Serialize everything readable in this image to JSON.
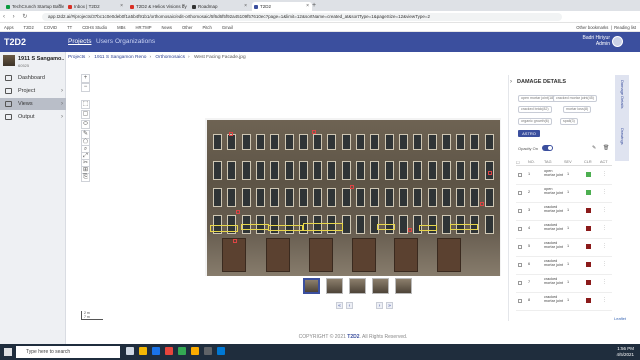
{
  "browser": {
    "tabs": [
      {
        "label": "TechCrunch Startup Battlefield 2",
        "color": "#0a9b3f"
      },
      {
        "label": "Inbox | T2D2",
        "color": "#d93025"
      },
      {
        "label": "T2D2 & Helios Visions by Thorn",
        "color": "#d93025"
      },
      {
        "label": "Roadmap",
        "color": "#333333"
      },
      {
        "label": "T2D2",
        "color": "#3b4f9e",
        "active": true
      }
    ],
    "url": "app.t2d2.ai/#/projects/37bc1c0e0deb0f1a5b4f91b1/orthomosaic/edit-orthomosaic/5f6d6f5f92a45109f57610ec?page=1&limit=12&sortName=created_at&sortType=1&pageSize=12&viewType=2",
    "bookmarks": [
      "Apps",
      "T2D2",
      "COVID",
      "TT",
      "CDHS Studio",
      "MBs",
      "HR:TMP",
      "News",
      "Other",
      "Pitch",
      "Gmail"
    ],
    "other_bookmarks": "Other bookmarks",
    "reading_list": "Reading list"
  },
  "app": {
    "logo": "T2D2",
    "nav": [
      "Projects",
      "Users",
      "Organizations"
    ],
    "user": {
      "name": "Badri Hiriyur",
      "role": "Admin"
    }
  },
  "sidebar": {
    "project_name": "1911 S Sangamo...",
    "project_sub": "60525",
    "items": [
      {
        "label": "Dashboard"
      },
      {
        "label": "Project"
      },
      {
        "label": "Views",
        "active": true
      },
      {
        "label": "Output"
      }
    ]
  },
  "breadcrumb": [
    "Projects",
    "1911 S Sangamon Reno",
    "Orthomosaics",
    "West Facing Facade.jpg"
  ],
  "viewer": {
    "toolbar": [
      "+",
      "−",
      "⬚",
      "▢",
      "⬭",
      "✎",
      "⬠",
      "⌕",
      "⤢",
      "✂",
      "⊞",
      "⎘"
    ],
    "thumb_count": 5,
    "pager": [
      "«",
      "‹",
      "›",
      "»"
    ],
    "scale": {
      "top": "2 m",
      "bottom": "7 m"
    }
  },
  "footer": {
    "prefix": "COPYRIGHT © 2021 ",
    "brand": "T2D2",
    "suffix": ". All Rights Reserved."
  },
  "leaflet": "Leaflet",
  "damage_panel": {
    "title": "DAMAGE DETAILS",
    "side_tabs": [
      "Damage Details",
      "Drawings"
    ],
    "chips": [
      "open mortar joint(18)",
      "cracked mortar joint(45)",
      "cracked brick(82)",
      "mortar loss(8)",
      "organic growth(6)",
      "spall(3)"
    ],
    "filter_button": "ASTRO",
    "opacity_label": "Opacity On",
    "columns": [
      "NO.",
      "TAG",
      "SEV",
      "CLR",
      "ACT"
    ],
    "rows": [
      {
        "no": "1",
        "tag": "open mortar joint",
        "sev": "1",
        "color": "#4caf50"
      },
      {
        "no": "2",
        "tag": "open mortar joint",
        "sev": "1",
        "color": "#4caf50"
      },
      {
        "no": "3",
        "tag": "cracked mortar joint",
        "sev": "1",
        "color": "#8b1a1a"
      },
      {
        "no": "4",
        "tag": "cracked mortar joint",
        "sev": "1",
        "color": "#8b1a1a"
      },
      {
        "no": "5",
        "tag": "cracked mortar joint",
        "sev": "1",
        "color": "#8b1a1a"
      },
      {
        "no": "6",
        "tag": "cracked mortar joint",
        "sev": "1",
        "color": "#8b1a1a"
      },
      {
        "no": "7",
        "tag": "cracked mortar joint",
        "sev": "1",
        "color": "#8b1a1a"
      },
      {
        "no": "8",
        "tag": "cracked mortar joint",
        "sev": "1",
        "color": "#8b1a1a"
      }
    ]
  },
  "taskbar": {
    "search_placeholder": "Type here to search",
    "time": "1:56 PM",
    "date": "4/5/2021"
  }
}
